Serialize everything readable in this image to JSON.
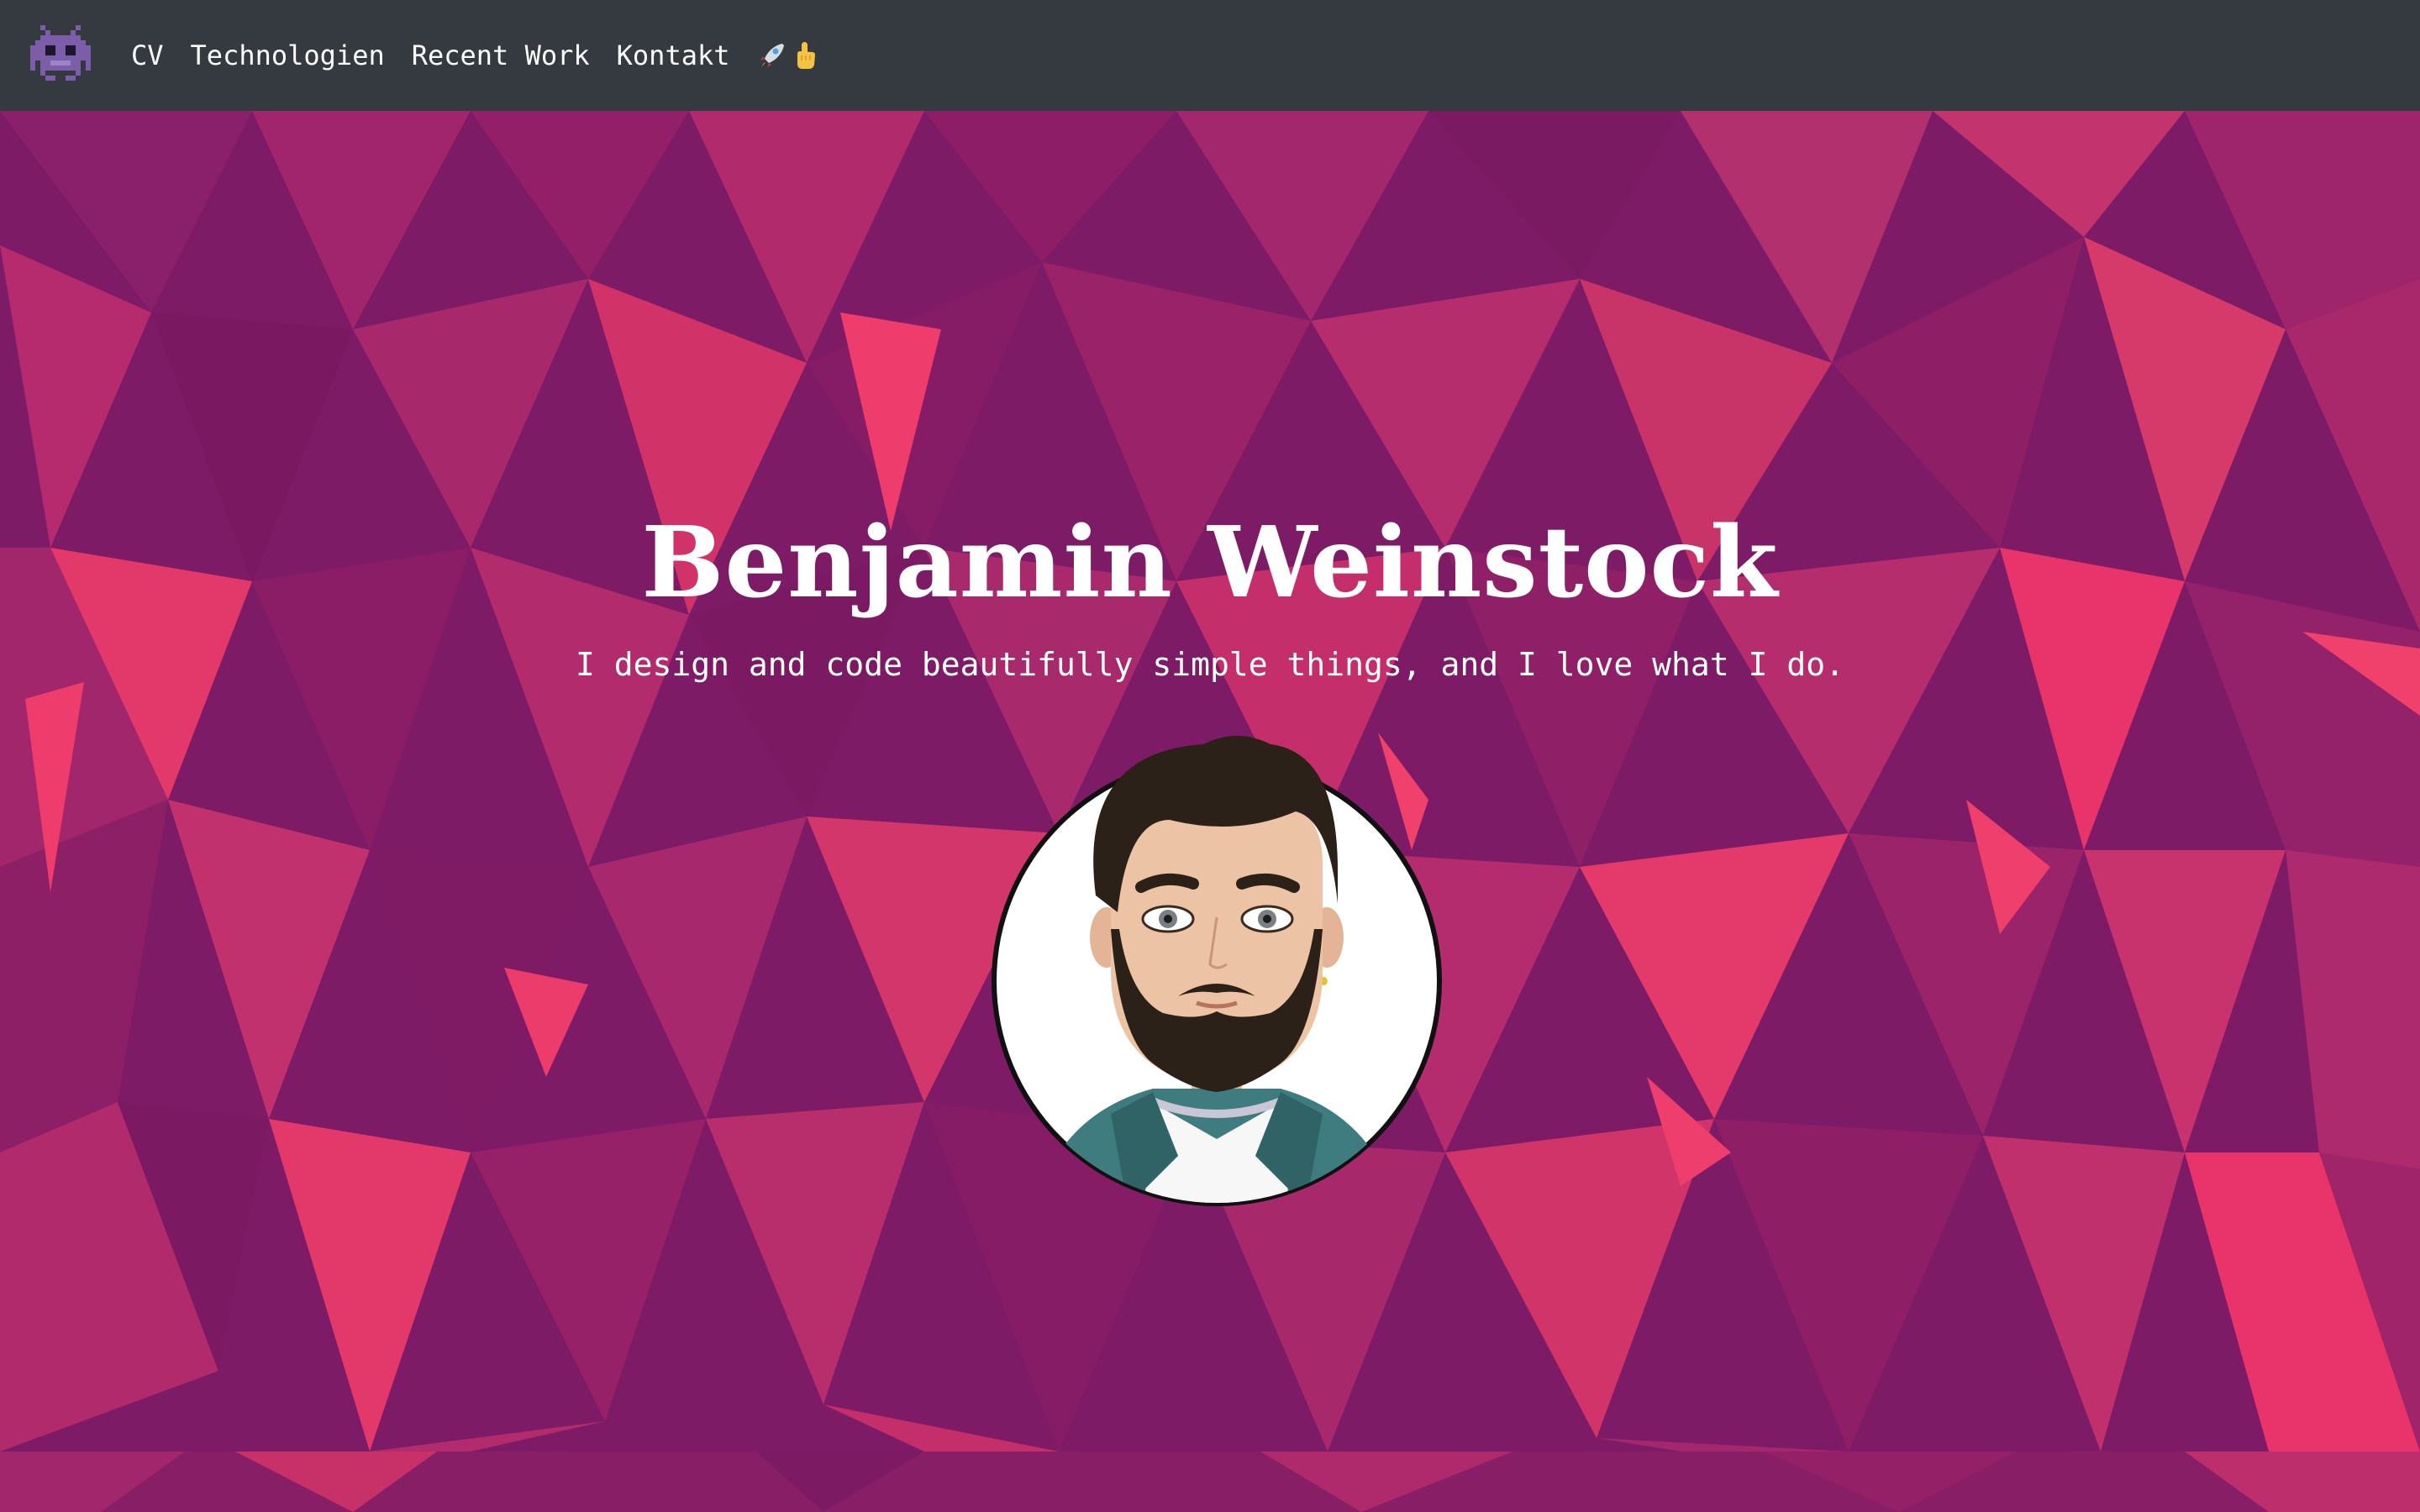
{
  "nav": {
    "brand_icon": "alien-monster-icon",
    "items": [
      {
        "label": "CV"
      },
      {
        "label": "Technologien"
      },
      {
        "label": "Recent Work"
      },
      {
        "label": "Kontakt"
      }
    ],
    "emoji_icons": [
      "rocket-icon",
      "pointing-finger-icon"
    ]
  },
  "hero": {
    "title": "Benjamin Weinstock",
    "subtitle": "I design and code beautifully simple things, and I love what I do.",
    "avatar": "cartoon-portrait-avatar"
  },
  "colors": {
    "navbar": "#343a40",
    "hero_base": "#7d1b66",
    "hero_pink": "#e8336b",
    "text": "#ffffff"
  }
}
